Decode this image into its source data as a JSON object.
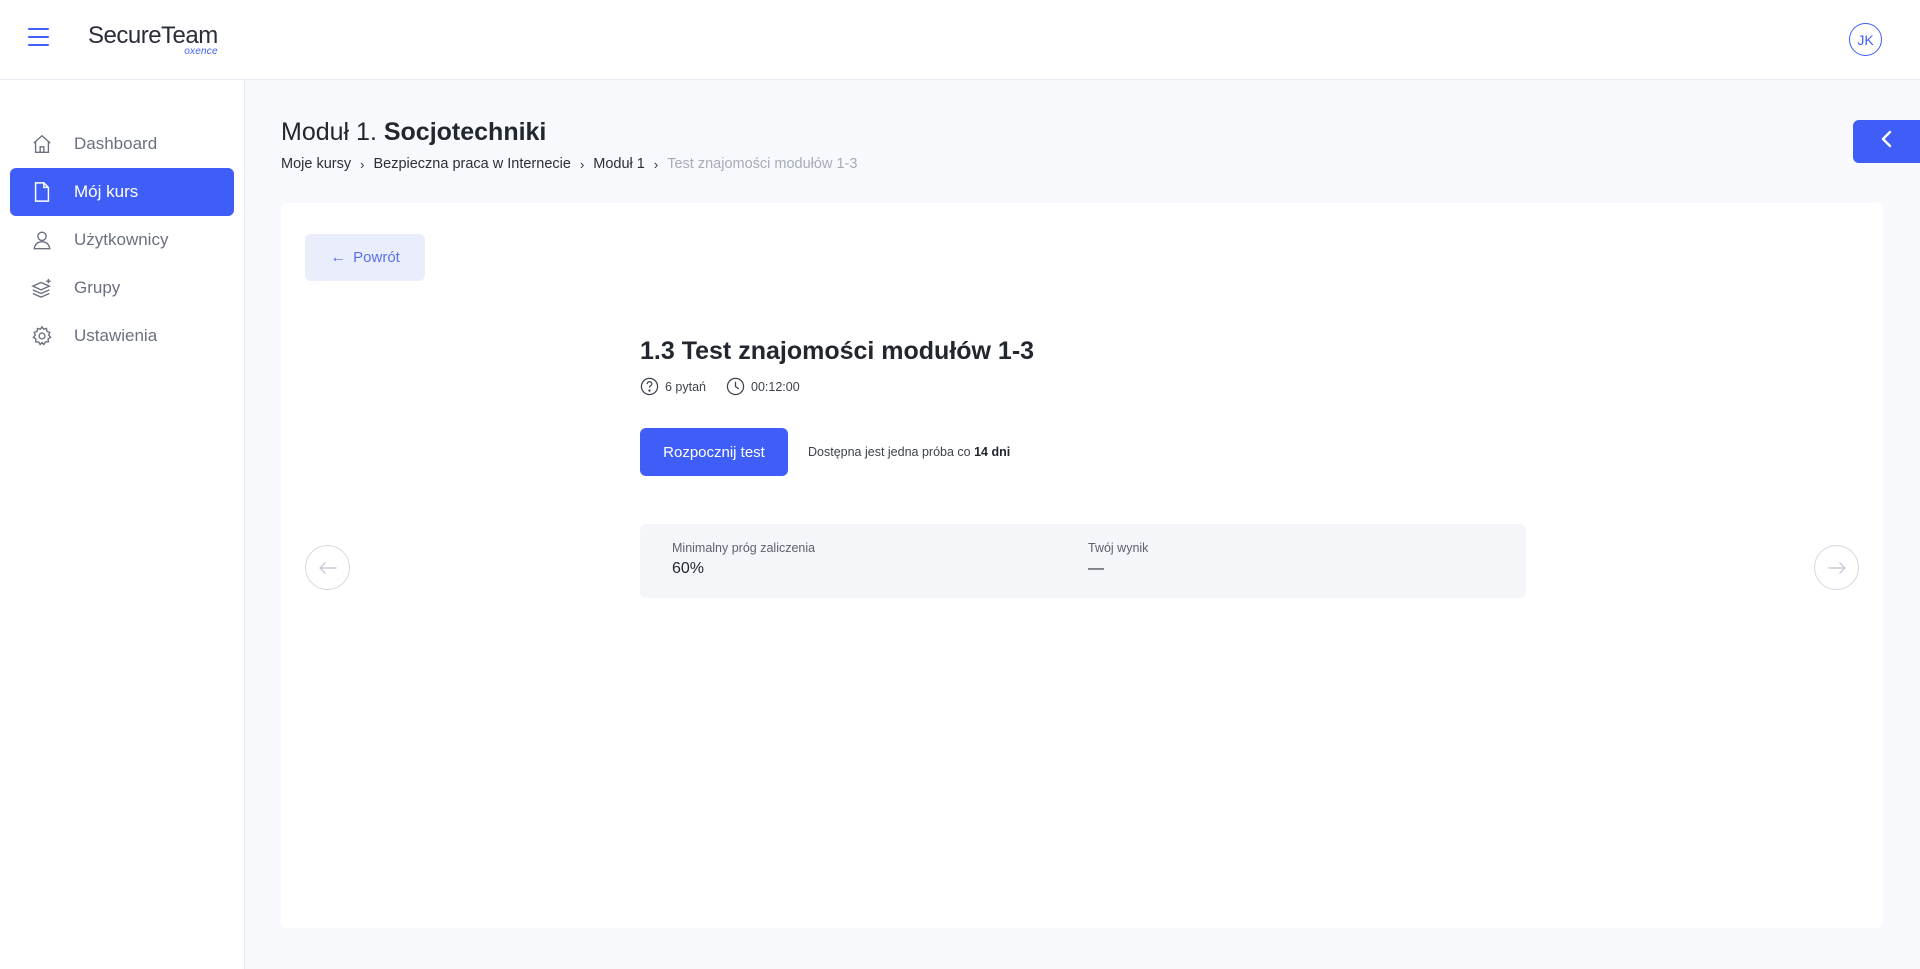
{
  "app": {
    "logo_main": "SecureTeam",
    "logo_sub": "oxence",
    "user_initials": "JK"
  },
  "sidebar": {
    "items": [
      {
        "label": "Dashboard",
        "icon": "home-icon",
        "active": false
      },
      {
        "label": "Mój kurs",
        "icon": "document-icon",
        "active": true
      },
      {
        "label": "Użytkownicy",
        "icon": "user-icon",
        "active": false
      },
      {
        "label": "Grupy",
        "icon": "layers-icon",
        "active": false
      },
      {
        "label": "Ustawienia",
        "icon": "gear-icon",
        "active": false
      }
    ]
  },
  "header": {
    "title_prefix": "Moduł 1.",
    "title_main": "Socjotechniki",
    "breadcrumb": [
      "Moje kursy",
      "Bezpieczna praca w Internecie",
      "Moduł 1",
      "Test znajomości modułów 1-3"
    ]
  },
  "test": {
    "back_label": "Powrót",
    "title": "1.3 Test znajomości modułów 1-3",
    "questions": "6 pytań",
    "duration": "00:12:00",
    "start_label": "Rozpocznij test",
    "attempt_note_prefix": "Dostępna jest jedna próba co",
    "attempt_note_bold": "14 dni",
    "pass_threshold_label": "Minimalny próg zaliczenia",
    "pass_threshold_value": "60%",
    "score_label": "Twój wynik",
    "score_value": "—"
  },
  "colors": {
    "accent": "#3f5ef8",
    "background": "#f7f9fc"
  }
}
